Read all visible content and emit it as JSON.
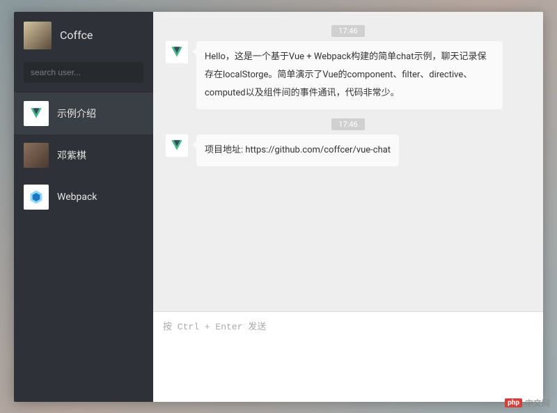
{
  "profile": {
    "name": "Coffce"
  },
  "search": {
    "placeholder": "search user..."
  },
  "sessions": [
    {
      "name": "示例介绍",
      "avatar": "vue",
      "active": true
    },
    {
      "name": "邓紫棋",
      "avatar": "person",
      "active": false
    },
    {
      "name": "Webpack",
      "avatar": "webpack",
      "active": false
    }
  ],
  "chat": {
    "messages": [
      {
        "time": "17:46",
        "avatar": "vue",
        "text": "Hello，这是一个基于Vue + Webpack构建的简单chat示例，聊天记录保存在localStorge。简单演示了Vue的component、filter、directive、computed以及组件间的事件通讯，代码非常少。"
      },
      {
        "time": "17:46",
        "avatar": "vue",
        "text": "项目地址: https://github.com/coffcer/vue-chat"
      }
    ]
  },
  "input": {
    "placeholder": "按 Ctrl + Enter 发送"
  },
  "watermark": {
    "logo": "php",
    "text": "中文网"
  }
}
